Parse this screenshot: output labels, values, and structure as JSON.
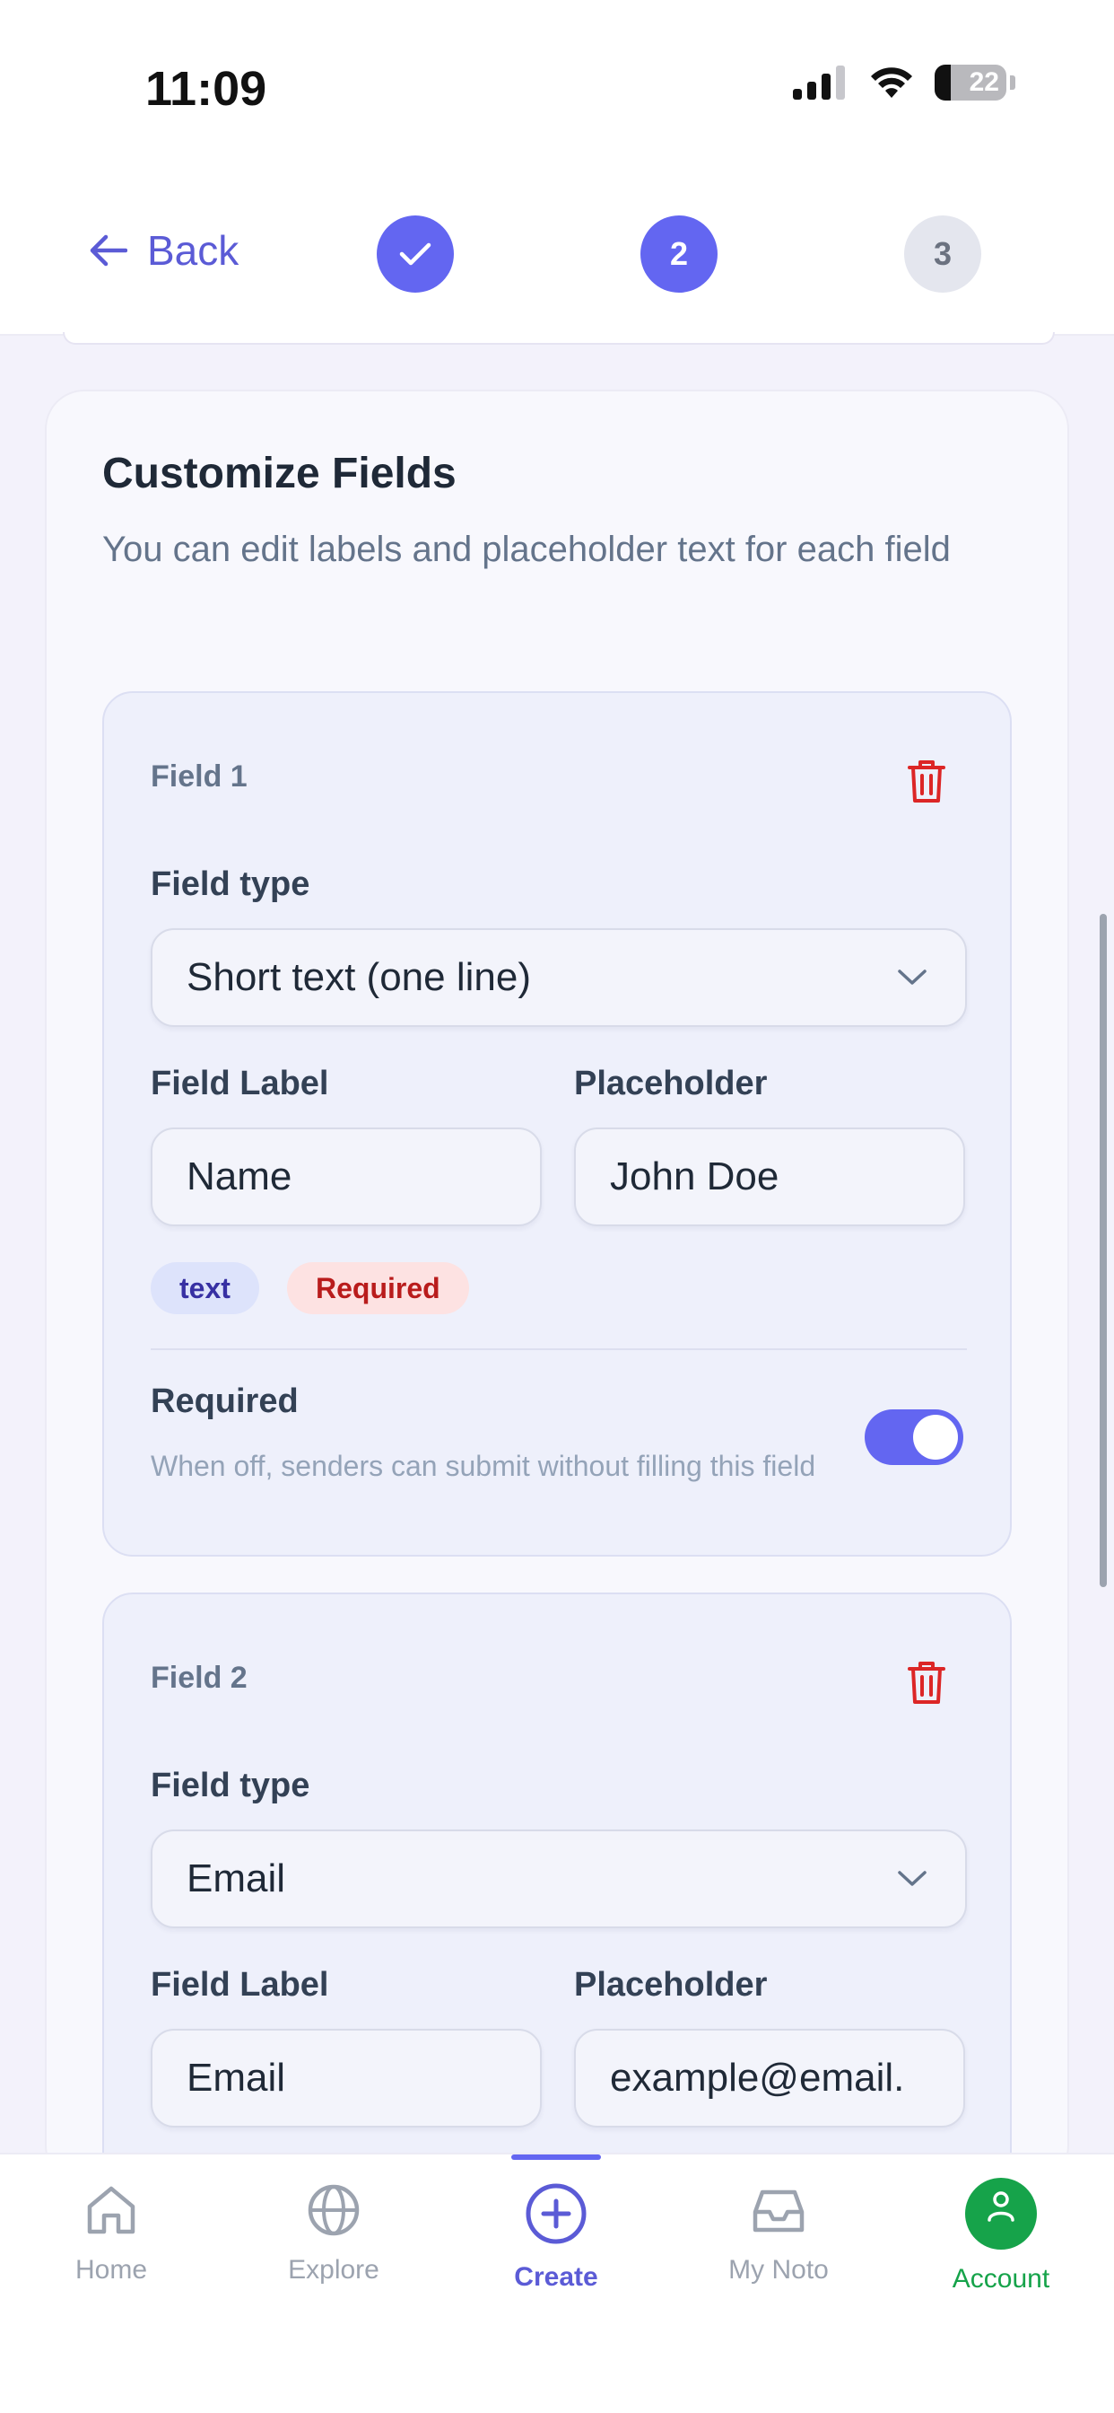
{
  "status": {
    "time": "11:09",
    "battery": "22"
  },
  "nav": {
    "back_label": "Back",
    "steps": [
      "2",
      "3"
    ]
  },
  "card": {
    "title": "Customize Fields",
    "subtitle": "You can edit labels and placeholder text for each field"
  },
  "fields": [
    {
      "name": "Field 1",
      "type_label": "Field type",
      "type_value": "Short text (one line)",
      "label_label": "Field Label",
      "label_value": "Name",
      "placeholder_label": "Placeholder",
      "placeholder_value": "John Doe",
      "badge_type": "text",
      "badge_required": "Required",
      "required_title": "Required",
      "required_desc": "When off, senders can submit without filling this field",
      "required_on": true
    },
    {
      "name": "Field 2",
      "type_label": "Field type",
      "type_value": "Email",
      "label_label": "Field Label",
      "label_value": "Email",
      "placeholder_label": "Placeholder",
      "placeholder_value": "example@email."
    }
  ],
  "tabs": [
    {
      "label": "Home",
      "icon": "home-icon"
    },
    {
      "label": "Explore",
      "icon": "globe-icon"
    },
    {
      "label": "Create",
      "icon": "plus-circle-icon"
    },
    {
      "label": "My Noto",
      "icon": "inbox-icon"
    },
    {
      "label": "Account",
      "icon": "user-icon"
    }
  ],
  "colors": {
    "accent": "#6366f1",
    "danger": "#dc2626",
    "account_green": "#16a34a"
  }
}
